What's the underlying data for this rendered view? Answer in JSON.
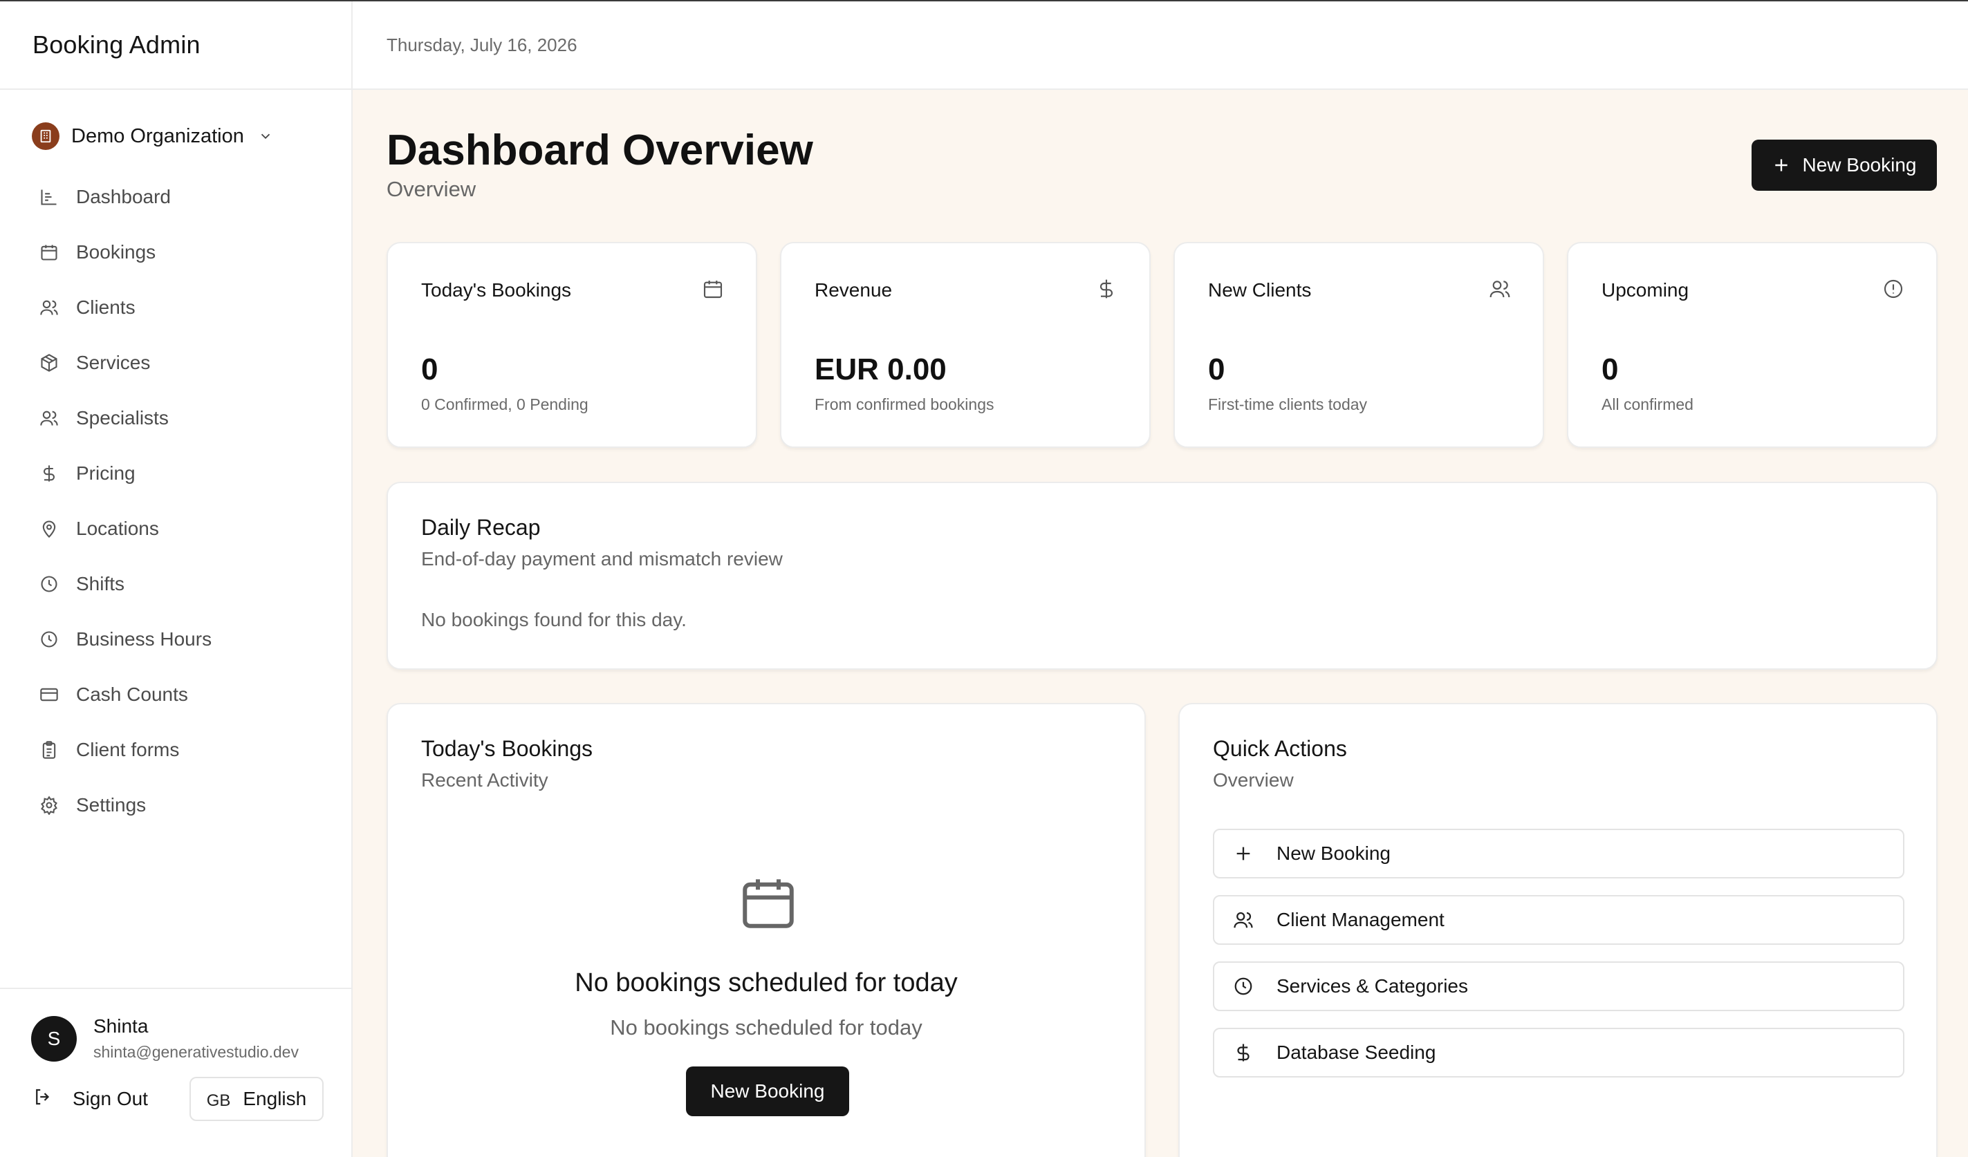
{
  "sidebar": {
    "brand": "Booking Admin",
    "organization": "Demo Organization",
    "nav": [
      {
        "label": "Dashboard",
        "icon": "bar-chart-icon"
      },
      {
        "label": "Bookings",
        "icon": "calendar-icon"
      },
      {
        "label": "Clients",
        "icon": "users-icon"
      },
      {
        "label": "Services",
        "icon": "package-icon"
      },
      {
        "label": "Specialists",
        "icon": "users-icon"
      },
      {
        "label": "Pricing",
        "icon": "dollar-icon"
      },
      {
        "label": "Locations",
        "icon": "map-pin-icon"
      },
      {
        "label": "Shifts",
        "icon": "clock-icon"
      },
      {
        "label": "Business Hours",
        "icon": "clock-icon"
      },
      {
        "label": "Cash Counts",
        "icon": "credit-card-icon"
      },
      {
        "label": "Client forms",
        "icon": "clipboard-icon"
      },
      {
        "label": "Settings",
        "icon": "gear-icon"
      }
    ],
    "user": {
      "initial": "S",
      "name": "Shinta",
      "email": "shinta@generativestudio.dev"
    },
    "sign_out": "Sign Out",
    "language": {
      "code": "GB",
      "label": "English"
    }
  },
  "topbar": {
    "date": "Thursday, July 16, 2026"
  },
  "header": {
    "title": "Dashboard Overview",
    "subtitle": "Overview",
    "new_booking": "New Booking"
  },
  "stats": [
    {
      "title": "Today's Bookings",
      "value": "0",
      "desc": "0 Confirmed, 0 Pending",
      "icon": "calendar-icon"
    },
    {
      "title": "Revenue",
      "value": "EUR 0.00",
      "desc": "From confirmed bookings",
      "icon": "dollar-icon"
    },
    {
      "title": "New Clients",
      "value": "0",
      "desc": "First-time clients today",
      "icon": "users-icon"
    },
    {
      "title": "Upcoming",
      "value": "0",
      "desc": "All confirmed",
      "icon": "alert-circle-icon"
    }
  ],
  "recap": {
    "title": "Daily Recap",
    "subtitle": "End-of-day payment and mismatch review",
    "empty": "No bookings found for this day."
  },
  "today": {
    "title": "Today's Bookings",
    "subtitle": "Recent Activity",
    "empty_title": "No bookings scheduled for today",
    "empty_sub": "No bookings scheduled for today",
    "button": "New Booking"
  },
  "quick": {
    "title": "Quick Actions",
    "subtitle": "Overview",
    "actions": [
      {
        "label": "New Booking",
        "icon": "plus-icon"
      },
      {
        "label": "Client Management",
        "icon": "users-icon"
      },
      {
        "label": "Services & Categories",
        "icon": "clock-icon"
      },
      {
        "label": "Database Seeding",
        "icon": "dollar-icon"
      }
    ]
  },
  "colors": {
    "page_background": "#fcf6ef",
    "primary_button": "#161616",
    "org_logo": "#8a3d1c"
  }
}
